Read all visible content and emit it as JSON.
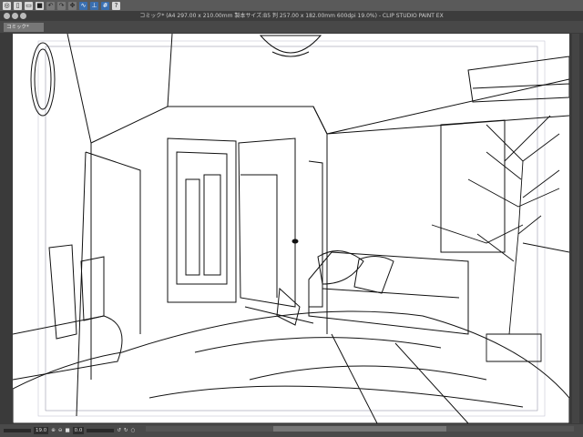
{
  "command_bar": {
    "icons": [
      "settings-icon",
      "new-file-icon",
      "open-file-icon",
      "save-icon",
      "undo-icon",
      "redo-icon",
      "transform-icon",
      "snap-ruler-icon",
      "snap-special-ruler-icon",
      "snap-grid-icon",
      "help-icon"
    ]
  },
  "window": {
    "title": "コミック* (A4 297.00 x 210.00mm 製本サイズ:B5 判 257.00 x 182.00mm 600dpi 19.0%)  - CLIP STUDIO PAINT EX"
  },
  "tab": {
    "label": "コミック*"
  },
  "status": {
    "zoom": "19.0",
    "rotation": "0.0"
  },
  "colors": {
    "accent": "#3a6fb0"
  }
}
